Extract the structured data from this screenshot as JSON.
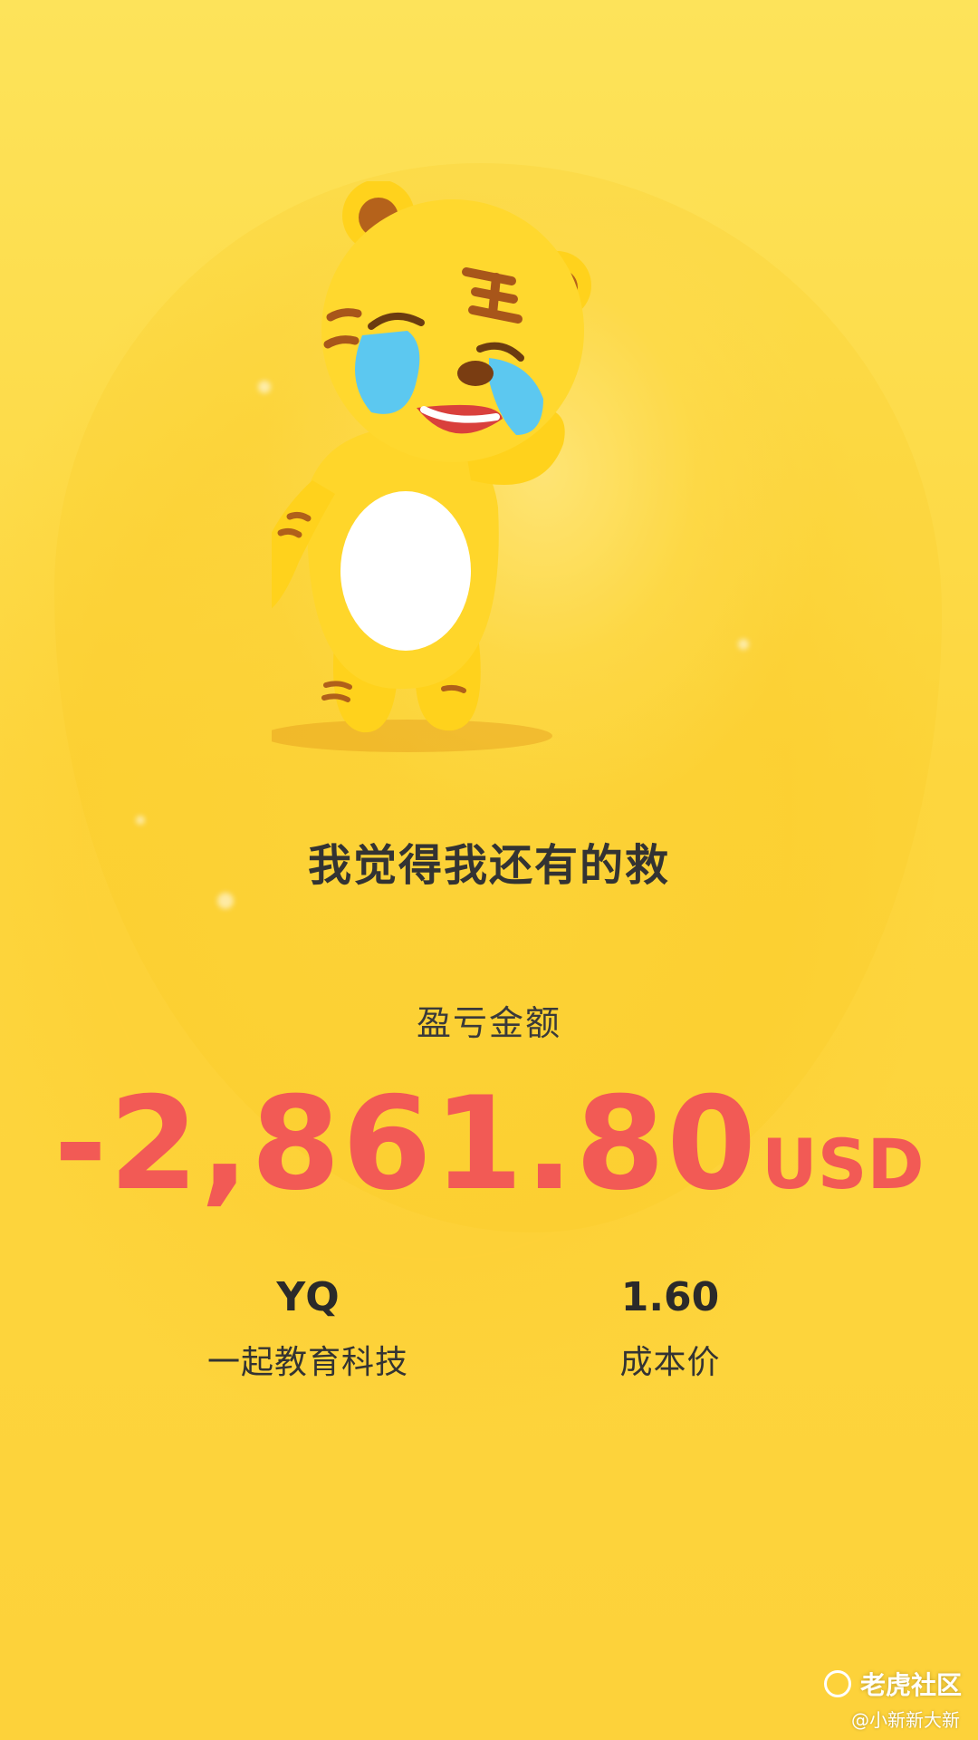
{
  "headline": "我觉得我还有的救",
  "pnl": {
    "label": "盈亏金额",
    "amount": "-2,861.80",
    "currency": "USD",
    "color": "#f25a55"
  },
  "stock": {
    "ticker": "YQ",
    "name": "一起教育科技"
  },
  "cost": {
    "value": "1.60",
    "label": "成本价"
  },
  "watermark": {
    "brand": "老虎社区",
    "credit": "@小新新大新"
  },
  "mascot": {
    "icon": "crying-tiger-mascot-icon"
  },
  "colors": {
    "background": "#fdd43a",
    "text": "#333333"
  }
}
